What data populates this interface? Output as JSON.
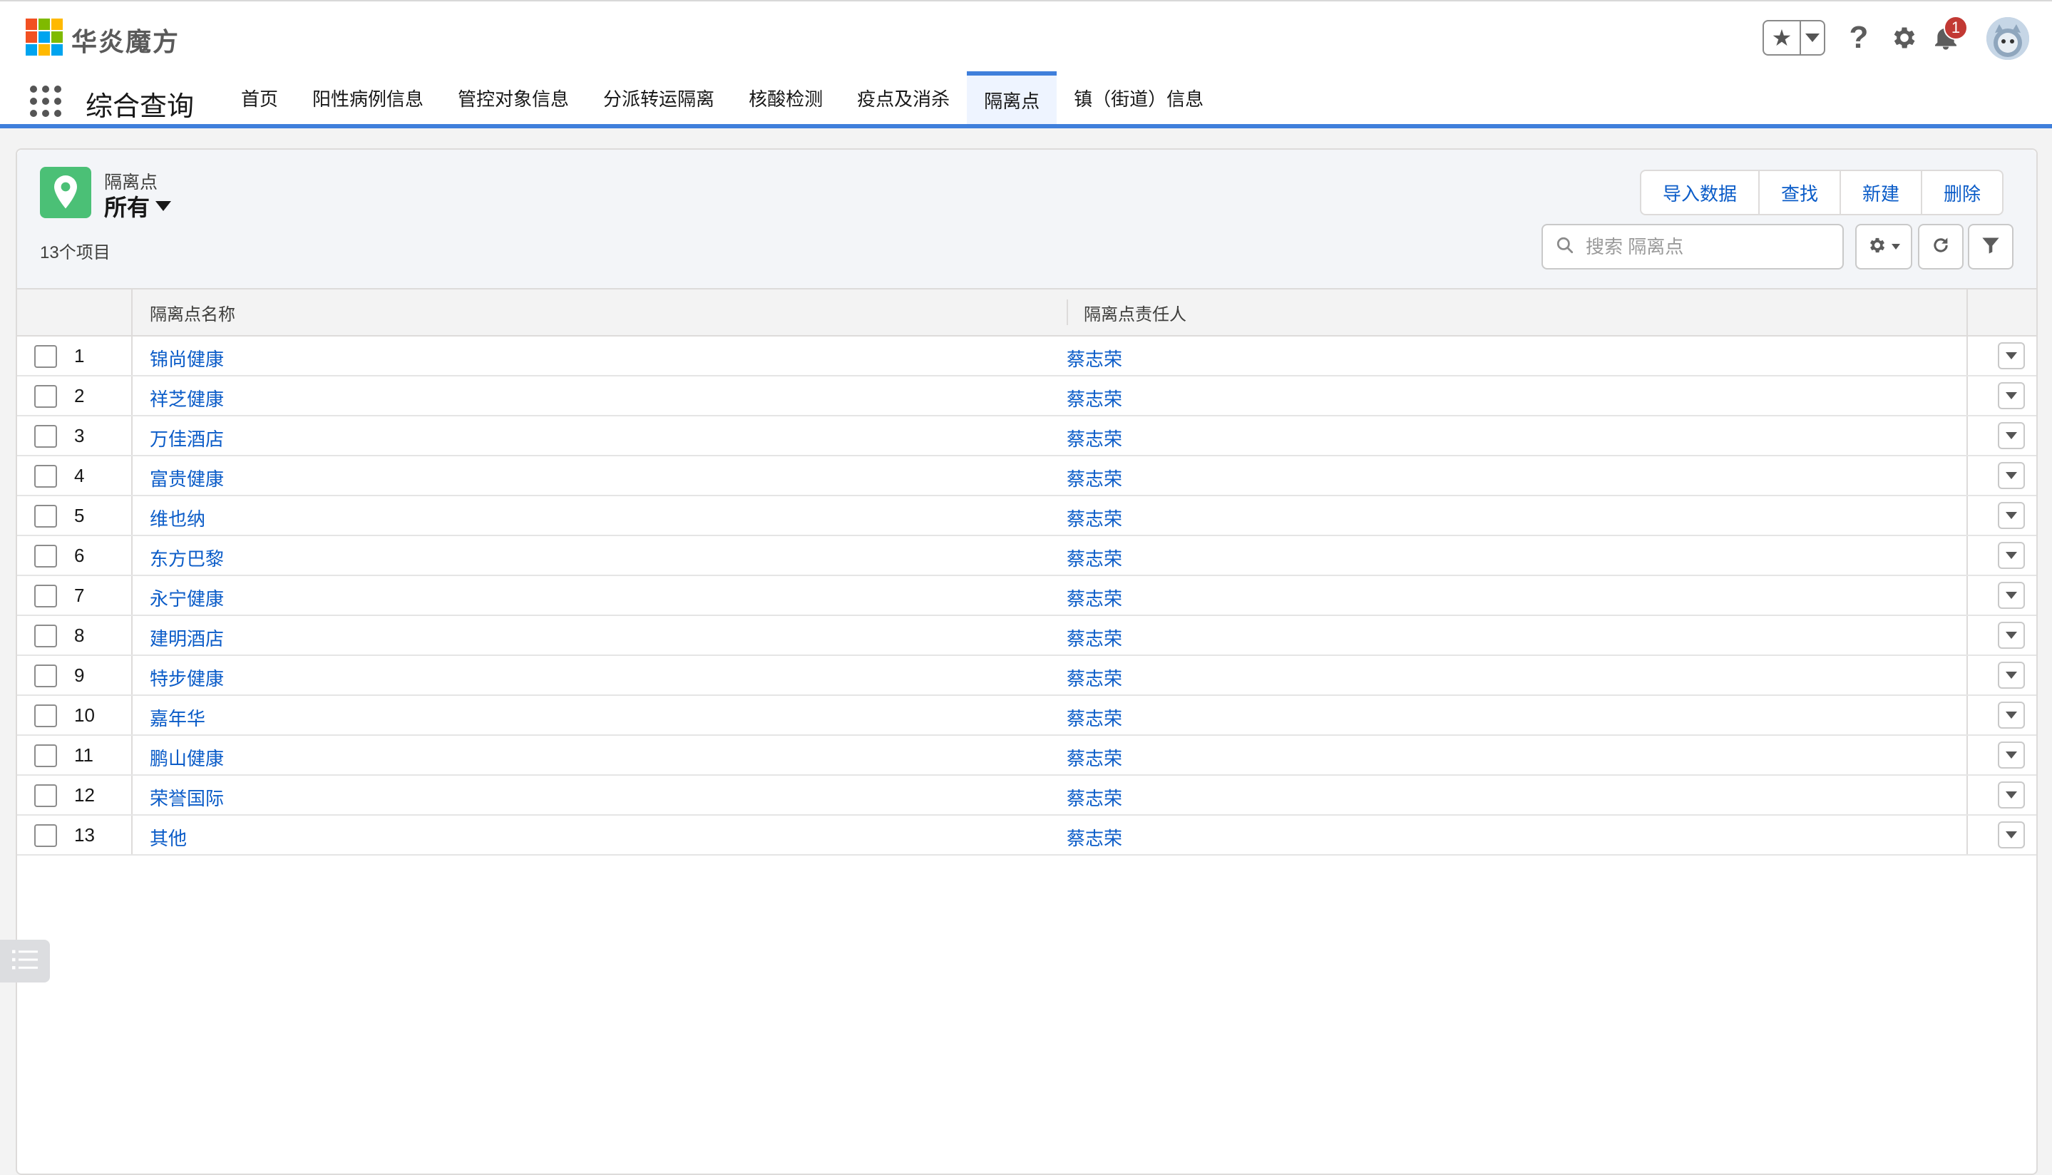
{
  "header": {
    "brand_name": "华炎魔方",
    "logo_colors": [
      "#f25022",
      "#7fba00",
      "#00a4ef",
      "#ffb900"
    ],
    "notification_count": "1"
  },
  "app_nav": {
    "app_name": "综合查询",
    "tabs": [
      {
        "label": "首页",
        "active": false
      },
      {
        "label": "阳性病例信息",
        "active": false
      },
      {
        "label": "管控对象信息",
        "active": false
      },
      {
        "label": "分派转运隔离",
        "active": false
      },
      {
        "label": "核酸检测",
        "active": false
      },
      {
        "label": "疫点及消杀",
        "active": false
      },
      {
        "label": "隔离点",
        "active": true
      },
      {
        "label": "镇（街道）信息",
        "active": false
      }
    ],
    "accent_color": "#3f7fdb"
  },
  "list_view": {
    "object_label": "隔离点",
    "view_name": "所有",
    "item_count": "13个项目",
    "actions": [
      "导入数据",
      "查找",
      "新建",
      "删除"
    ],
    "search_placeholder": "搜索 隔离点",
    "columns": [
      "隔离点名称",
      "隔离点责任人"
    ],
    "rows": [
      {
        "num": "1",
        "name": "锦尚健康",
        "owner": "蔡志荣"
      },
      {
        "num": "2",
        "name": "祥芝健康",
        "owner": "蔡志荣"
      },
      {
        "num": "3",
        "name": "万佳酒店",
        "owner": "蔡志荣"
      },
      {
        "num": "4",
        "name": "富贵健康",
        "owner": "蔡志荣"
      },
      {
        "num": "5",
        "name": "维也纳",
        "owner": "蔡志荣"
      },
      {
        "num": "6",
        "name": "东方巴黎",
        "owner": "蔡志荣"
      },
      {
        "num": "7",
        "name": "永宁健康",
        "owner": "蔡志荣"
      },
      {
        "num": "8",
        "name": "建明酒店",
        "owner": "蔡志荣"
      },
      {
        "num": "9",
        "name": "特步健康",
        "owner": "蔡志荣"
      },
      {
        "num": "10",
        "name": "嘉年华",
        "owner": "蔡志荣"
      },
      {
        "num": "11",
        "name": "鹏山健康",
        "owner": "蔡志荣"
      },
      {
        "num": "12",
        "name": "荣誉国际",
        "owner": "蔡志荣"
      },
      {
        "num": "13",
        "name": "其他",
        "owner": "蔡志荣"
      }
    ],
    "link_color": "#0b5cc8",
    "object_icon_color": "#4bc076"
  }
}
